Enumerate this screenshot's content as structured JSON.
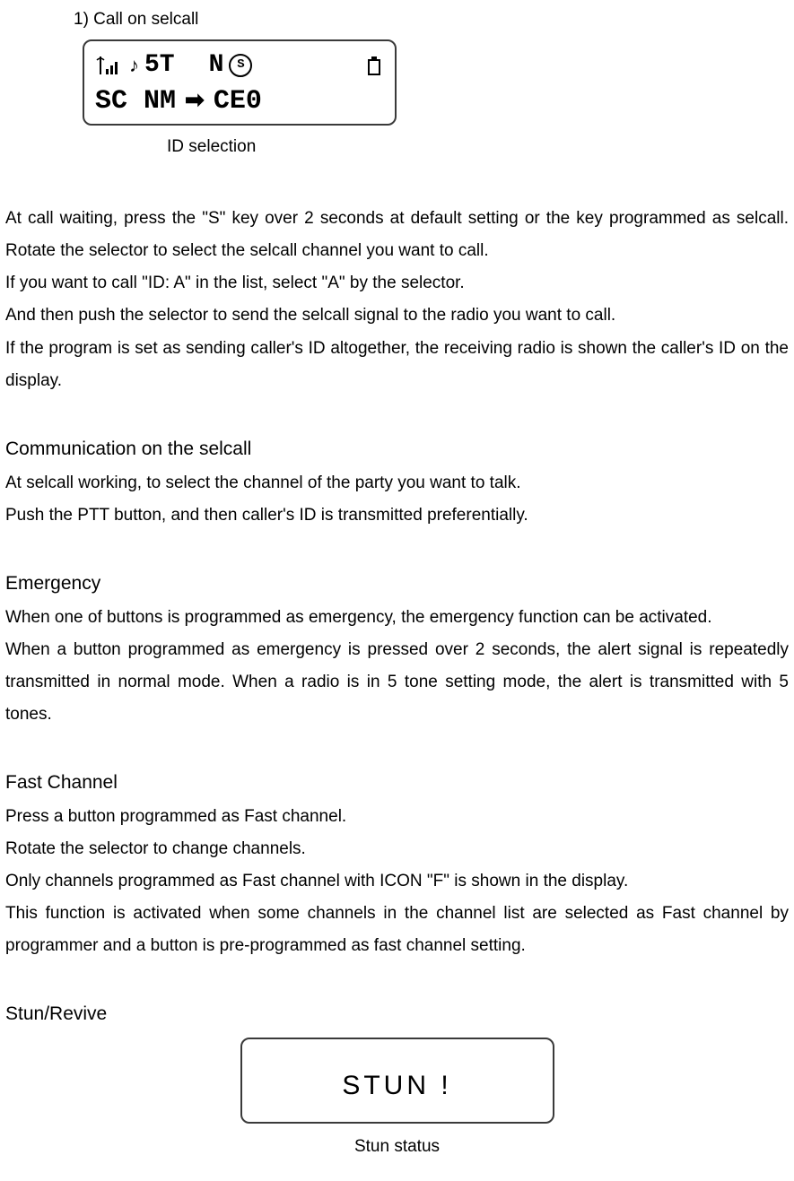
{
  "listItem1": "1)  Call on selcall",
  "lcd1": {
    "note": "♪",
    "fiveT": "5T",
    "n": "N",
    "sCircle": "S",
    "sc": "SC",
    "nm": "NM",
    "arrow": "➡",
    "ceo": "CE0",
    "caption": "ID selection"
  },
  "para1": "At call waiting, press the \"S\" key over 2 seconds at default setting or the key programmed as selcall.   Rotate the selector to select the selcall channel you want to call.",
  "para2": "If you want to call \"ID: A\" in the list, select \"A\" by the selector.",
  "para3": "And then push the selector to send the selcall signal to the radio you want to call.",
  "para4": "If the program is set as sending caller's ID altogether, the receiving radio is shown the caller's ID on the display.",
  "commTitle": "Communication on the selcall",
  "comm1": "At selcall working, to select the channel of the party you want to talk.",
  "comm2": "Push the PTT button, and then caller's ID is transmitted preferentially.",
  "emTitle": "Emergency",
  "em1": "When one of buttons is programmed as emergency, the emergency function can be activated.",
  "em2": "When a button programmed as emergency is pressed over 2 seconds, the alert signal is repeatedly transmitted in normal mode. When a radio is in 5 tone setting mode, the alert is transmitted with 5 tones.",
  "fcTitle": "Fast Channel",
  "fc1": "Press a button programmed as Fast channel.",
  "fc2": "Rotate the selector to change channels.",
  "fc3": "Only channels programmed as Fast channel with ICON \"F\" is shown in the display.",
  "fc4": "This function is activated when some channels in the channel list are selected as Fast channel by programmer and a button is pre-programmed as fast channel setting.",
  "srTitle": "Stun/Revive",
  "lcd2": {
    "text": "STUN !",
    "caption": "Stun status"
  }
}
